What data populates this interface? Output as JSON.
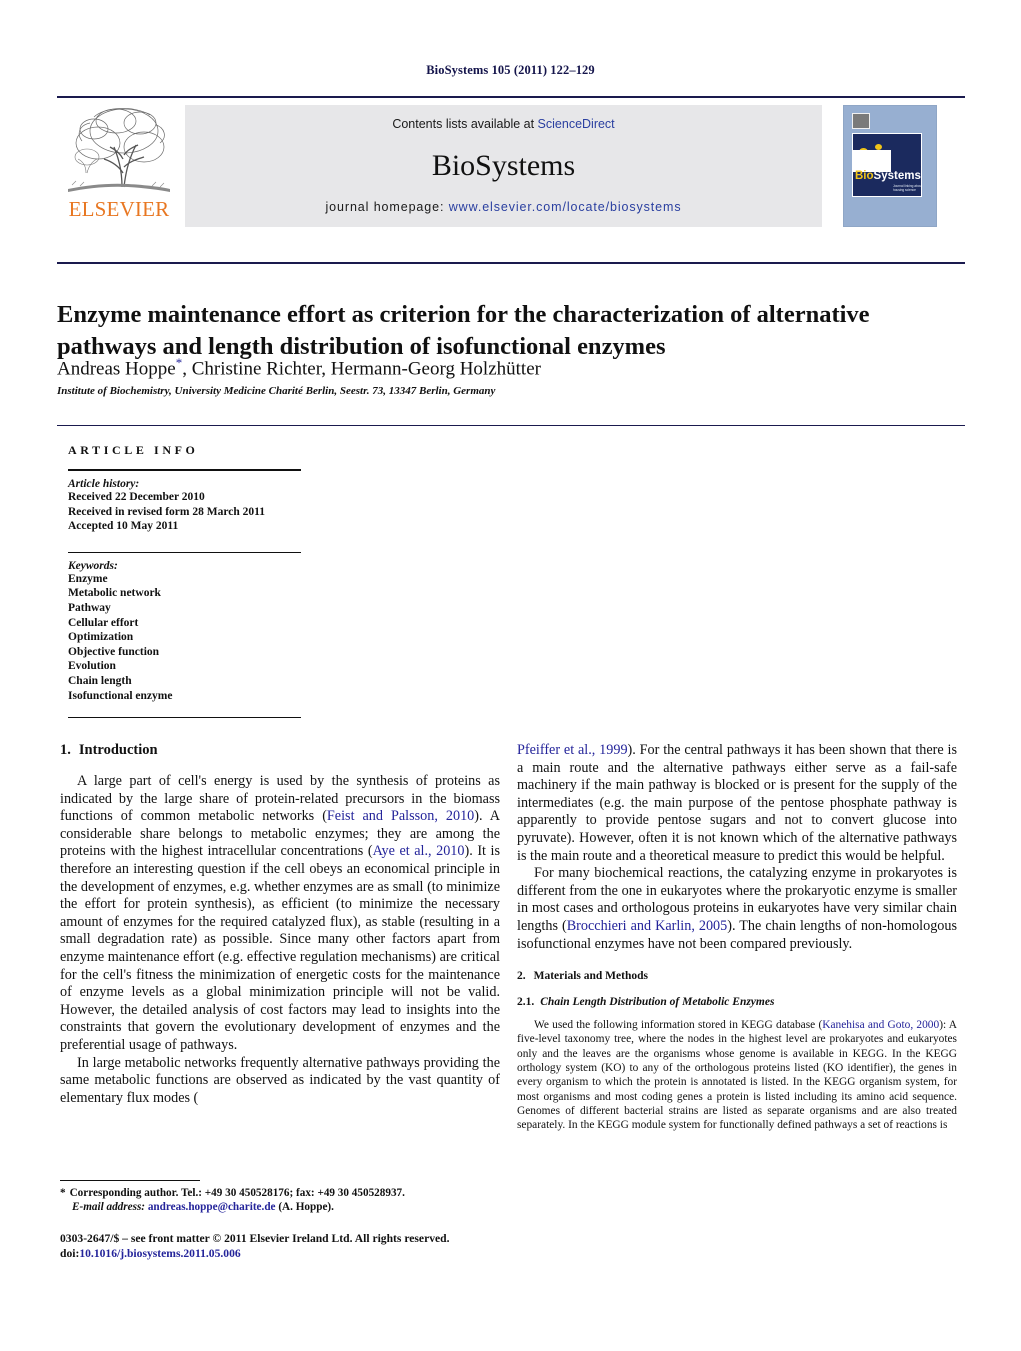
{
  "running_head": "BioSystems 105 (2011) 122–129",
  "masthead": {
    "publisher_name": "ELSEVIER",
    "contents_prefix": "Contents lists available at ",
    "contents_link": "ScienceDirect",
    "journal_name": "BioSystems",
    "homepage_prefix": "journal homepage: ",
    "homepage_link": "www.elsevier.com/locate/biosystems",
    "cover": {
      "title_bio": "Bio",
      "title_systems": "Systems",
      "subtitle": "Journal linking about science housing science"
    }
  },
  "article": {
    "title": "Enzyme maintenance effort as criterion for the characterization of alternative pathways and length distribution of isofunctional enzymes",
    "authors": "Andreas Hoppe",
    "authors_rest": ", Christine Richter, Hermann-Georg Holzhütter",
    "corresponding_marker": "*",
    "affiliation": "Institute of Biochemistry, University Medicine Charité Berlin, Seestr. 73, 13347 Berlin, Germany"
  },
  "article_info": {
    "heading": "ARTICLE INFO",
    "history_label": "Article history:",
    "history": [
      "Received 22 December 2010",
      "Received in revised form 28 March 2011",
      "Accepted 10 May 2011"
    ],
    "keywords_label": "Keywords:",
    "keywords": [
      "Enzyme",
      "Metabolic network",
      "Pathway",
      "Cellular effort",
      "Optimization",
      "Objective function",
      "Evolution",
      "Chain length",
      "Isofunctional enzyme"
    ]
  },
  "sections": {
    "introduction": {
      "number": "1.",
      "title": "Introduction",
      "paragraph_1_a": "A large part of cell's energy is used by the synthesis of proteins as indicated by the large share of protein-related precursors in the biomass functions of common metabolic networks (",
      "citation_1": "Feist and Palsson, 2010",
      "paragraph_1_b": "). A considerable share belongs to metabolic enzymes; they are among the proteins with the highest intracellular concentrations (",
      "citation_2": "Aye et al., 2010",
      "paragraph_1_c": "). It is therefore an interesting question if the cell obeys an economical principle in the development of enzymes, e.g. whether enzymes are as small (to minimize the effort for protein synthesis), as efficient (to minimize the necessary amount of enzymes for the required catalyzed flux), as stable (resulting in a small degradation rate) as possible. Since many other factors apart from enzyme maintenance effort (e.g. effective regulation mechanisms) are critical for the cell's fitness the minimization of energetic costs for the maintenance of enzyme levels as a global minimization principle will not be valid. However, the detailed analysis of cost factors may lead to insights into the constraints that govern the evolutionary development of enzymes and the preferential usage of pathways.",
      "paragraph_2_a": "In large metabolic networks frequently alternative pathways providing the same metabolic functions are observed as indicated by the vast quantity of elementary flux modes (",
      "citation_3": "Pfeiffer et al., 1999",
      "paragraph_2_b": "). For the central pathways it has been shown that there is a main route and the alternative pathways either serve as a fail-safe machinery if the main pathway is blocked or is present for the supply of the intermediates (e.g. the main purpose of the pentose phosphate pathway is apparently to provide pentose sugars and not to convert glucose into pyruvate). However, often it is not known which of the alternative pathways is the main route and a theoretical measure to predict this would be helpful.",
      "paragraph_3_a": "For many biochemical reactions, the catalyzing enzyme in prokaryotes is different from the one in eukaryotes where the prokaryotic enzyme is smaller in most cases and orthologous proteins in eukaryotes have very similar chain lengths (",
      "citation_4": "Brocchieri and Karlin, 2005",
      "paragraph_3_b": "). The chain lengths of non-homologous isofunctional enzymes have not been compared previously."
    },
    "methods": {
      "number": "2.",
      "title": "Materials and Methods",
      "subsection_number": "2.1.",
      "subsection_title": "Chain Length Distribution of Metabolic Enzymes",
      "paragraph_a": "We used the following information stored in KEGG database (",
      "citation_5": "Kanehisa and Goto, 2000",
      "paragraph_b": "): A five-level taxonomy tree, where the nodes in the highest level are prokaryotes and eukaryotes only and the leaves are the organisms whose genome is available in KEGG. In the KEGG orthology system (KO) to any of the orthologous proteins listed (KO identifier), the genes in every organism to which the protein is annotated is listed. In the KEGG organism system, for most organisms and most coding genes a protein is listed including its amino acid sequence. Genomes of different bacterial strains are listed as separate organisms and are also treated separately. In the KEGG module system for functionally defined pathways a set of reactions is"
    }
  },
  "footnotes": {
    "marker": "*",
    "corresponding": "Corresponding author. Tel.: +49 30 450528176; fax: +49 30 450528937.",
    "email_label": "E-mail address:",
    "email": "andreas.hoppe@charite.de",
    "email_suffix": " (A. Hoppe).",
    "copyright": "0303-2647/$ – see front matter © 2011 Elsevier Ireland Ltd. All rights reserved.",
    "doi_label": "doi:",
    "doi": "10.1016/j.biosystems.2011.05.006"
  },
  "colors": {
    "link": "#24249a",
    "elsevier_orange": "#e87722",
    "cover_blue": "#97afd1",
    "band_gray": "#e7e7e9"
  }
}
